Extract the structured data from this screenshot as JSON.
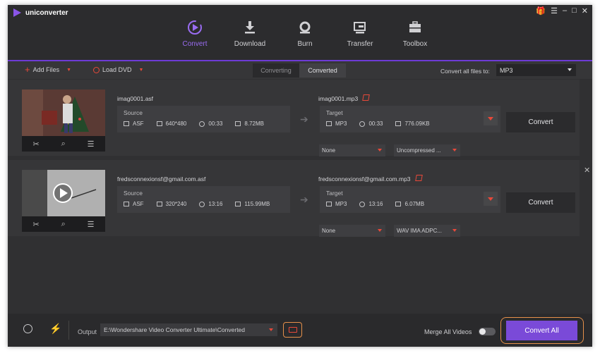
{
  "app": {
    "name": "uniconverter"
  },
  "nav": [
    {
      "label": "Convert",
      "icon": "convert-icon",
      "active": true
    },
    {
      "label": "Download",
      "icon": "download-icon"
    },
    {
      "label": "Burn",
      "icon": "burn-icon"
    },
    {
      "label": "Transfer",
      "icon": "transfer-icon"
    },
    {
      "label": "Toolbox",
      "icon": "toolbox-icon"
    }
  ],
  "toolbar": {
    "add_files": "Add Files",
    "load_dvd": "Load DVD",
    "tab_converting": "Converting",
    "tab_converted": "Converted",
    "convert_all_label": "Convert all files to:",
    "convert_all_format": "MP3"
  },
  "files": [
    {
      "source_name": "imag0001.asf",
      "target_name": "imag0001.mp3",
      "source": {
        "title": "Source",
        "format": "ASF",
        "resolution": "640*480",
        "duration": "00:33",
        "size": "8.72MB"
      },
      "target": {
        "title": "Target",
        "format": "MP3",
        "duration": "00:33",
        "size": "776.09KB"
      },
      "subtitle": "None",
      "audio": "Uncompressed ...",
      "convert": "Convert"
    },
    {
      "source_name": "fredsconnexionsf@gmail.com.asf",
      "target_name": "fredsconnexionsf@gmail.com.mp3",
      "source": {
        "title": "Source",
        "format": "ASF",
        "resolution": "320*240",
        "duration": "13:16",
        "size": "115.99MB"
      },
      "target": {
        "title": "Target",
        "format": "MP3",
        "duration": "13:16",
        "size": "6.07MB"
      },
      "subtitle": "None",
      "audio": "WAV IMA ADPC...",
      "convert": "Convert"
    }
  ],
  "bottom": {
    "output_label": "Output",
    "output_path": "E:\\Wondershare Video Converter Ultimate\\Converted",
    "merge_label": "Merge All Videos",
    "merge_on": false,
    "convert_all": "Convert All"
  },
  "colors": {
    "accent": "#7a4ad8",
    "highlight": "#e6904a",
    "red": "#e8493a"
  }
}
